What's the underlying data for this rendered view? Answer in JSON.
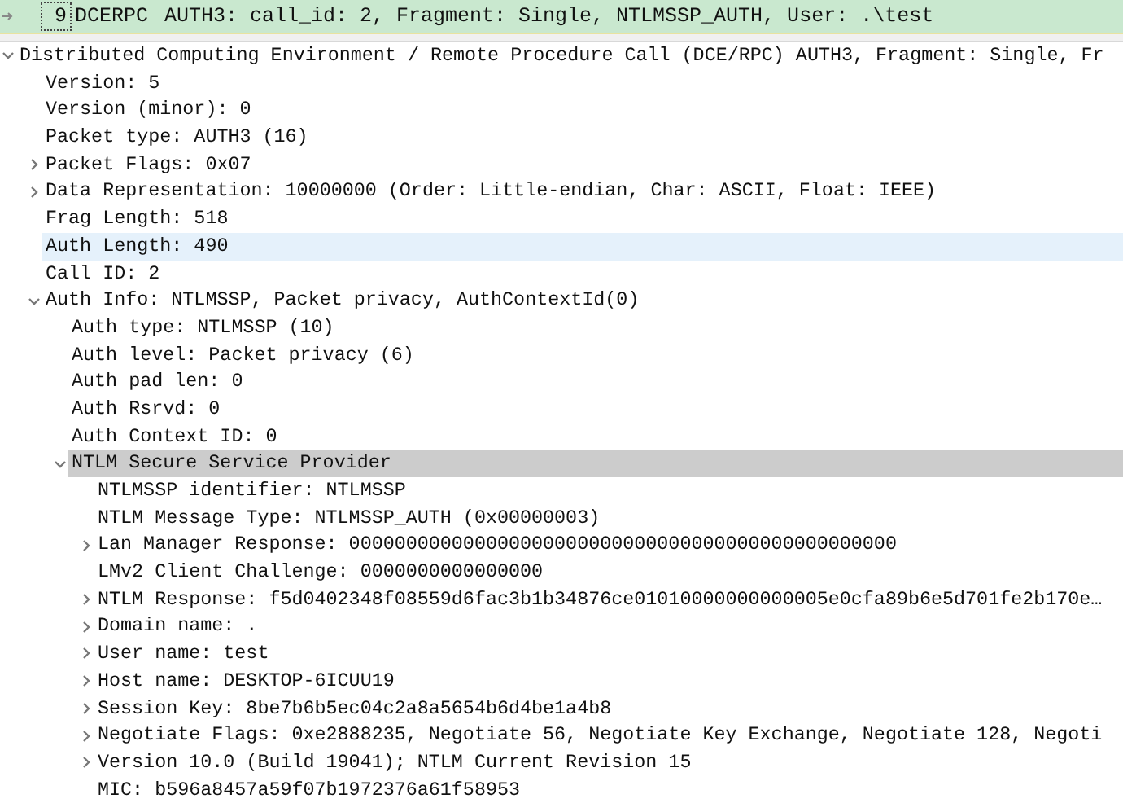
{
  "packet_list": {
    "row": {
      "number": "9",
      "protocol": "DCERPC",
      "info": "AUTH3: call_id: 2, Fragment: Single, NTLMSSP_AUTH, User: .\\test",
      "selected": true
    }
  },
  "details": {
    "tree": [
      {
        "kind": "branch",
        "expanded": true,
        "label": "Distributed Computing Environment / Remote Procedure Call (DCE/RPC) AUTH3, Fragment: Single, Fr",
        "selected": false,
        "hovered": false,
        "children": [
          {
            "kind": "leaf",
            "label": "Version: 5",
            "selected": false,
            "hovered": false
          },
          {
            "kind": "leaf",
            "label": "Version (minor): 0",
            "selected": false,
            "hovered": false
          },
          {
            "kind": "leaf",
            "label": "Packet type: AUTH3 (16)",
            "selected": false,
            "hovered": false
          },
          {
            "kind": "branch",
            "expanded": false,
            "label": "Packet Flags: 0x07",
            "selected": false,
            "hovered": false
          },
          {
            "kind": "branch",
            "expanded": false,
            "label": "Data Representation: 10000000 (Order: Little-endian, Char: ASCII, Float: IEEE)",
            "selected": false,
            "hovered": false
          },
          {
            "kind": "leaf",
            "label": "Frag Length: 518",
            "selected": false,
            "hovered": false
          },
          {
            "kind": "leaf",
            "label": "Auth Length: 490",
            "selected": false,
            "hovered": true
          },
          {
            "kind": "leaf",
            "label": "Call ID: 2",
            "selected": false,
            "hovered": false
          },
          {
            "kind": "branch",
            "expanded": true,
            "label": "Auth Info: NTLMSSP, Packet privacy, AuthContextId(0)",
            "selected": false,
            "hovered": false,
            "children": [
              {
                "kind": "leaf",
                "label": "Auth type: NTLMSSP (10)",
                "selected": false,
                "hovered": false
              },
              {
                "kind": "leaf",
                "label": "Auth level: Packet privacy (6)",
                "selected": false,
                "hovered": false
              },
              {
                "kind": "leaf",
                "label": "Auth pad len: 0",
                "selected": false,
                "hovered": false
              },
              {
                "kind": "leaf",
                "label": "Auth Rsrvd: 0",
                "selected": false,
                "hovered": false
              },
              {
                "kind": "leaf",
                "label": "Auth Context ID: 0",
                "selected": false,
                "hovered": false
              },
              {
                "kind": "branch",
                "expanded": true,
                "label": "NTLM Secure Service Provider",
                "selected": true,
                "hovered": false,
                "children": [
                  {
                    "kind": "leaf",
                    "label": "NTLMSSP identifier: NTLMSSP",
                    "selected": false,
                    "hovered": false
                  },
                  {
                    "kind": "leaf",
                    "label": "NTLM Message Type: NTLMSSP_AUTH (0x00000003)",
                    "selected": false,
                    "hovered": false
                  },
                  {
                    "kind": "branch",
                    "expanded": false,
                    "label": "Lan Manager Response: 000000000000000000000000000000000000000000000000",
                    "selected": false,
                    "hovered": false
                  },
                  {
                    "kind": "leaf",
                    "label": "LMv2 Client Challenge: 0000000000000000",
                    "selected": false,
                    "hovered": false
                  },
                  {
                    "kind": "branch",
                    "expanded": false,
                    "label": "NTLM Response: f5d0402348f08559d6fac3b1b34876ce01010000000000005e0cfa89b6e5d701fe2b170e…",
                    "selected": false,
                    "hovered": false
                  },
                  {
                    "kind": "branch",
                    "expanded": false,
                    "label": "Domain name: .",
                    "selected": false,
                    "hovered": false
                  },
                  {
                    "kind": "branch",
                    "expanded": false,
                    "label": "User name: test",
                    "selected": false,
                    "hovered": false
                  },
                  {
                    "kind": "branch",
                    "expanded": false,
                    "label": "Host name: DESKTOP-6ICUU19",
                    "selected": false,
                    "hovered": false
                  },
                  {
                    "kind": "branch",
                    "expanded": false,
                    "label": "Session Key: 8be7b6b5ec04c2a8a5654b6d4be1a4b8",
                    "selected": false,
                    "hovered": false
                  },
                  {
                    "kind": "branch",
                    "expanded": false,
                    "label": "Negotiate Flags: 0xe2888235, Negotiate 56, Negotiate Key Exchange, Negotiate 128, Negoti",
                    "selected": false,
                    "hovered": false
                  },
                  {
                    "kind": "branch",
                    "expanded": false,
                    "label": "Version 10.0 (Build 19041); NTLM Current Revision 15",
                    "selected": false,
                    "hovered": false
                  },
                  {
                    "kind": "leaf",
                    "label": "MIC: b596a8457a59f07b1972376a61f58953",
                    "selected": false,
                    "hovered": false
                  }
                ]
              }
            ]
          }
        ]
      }
    ]
  }
}
